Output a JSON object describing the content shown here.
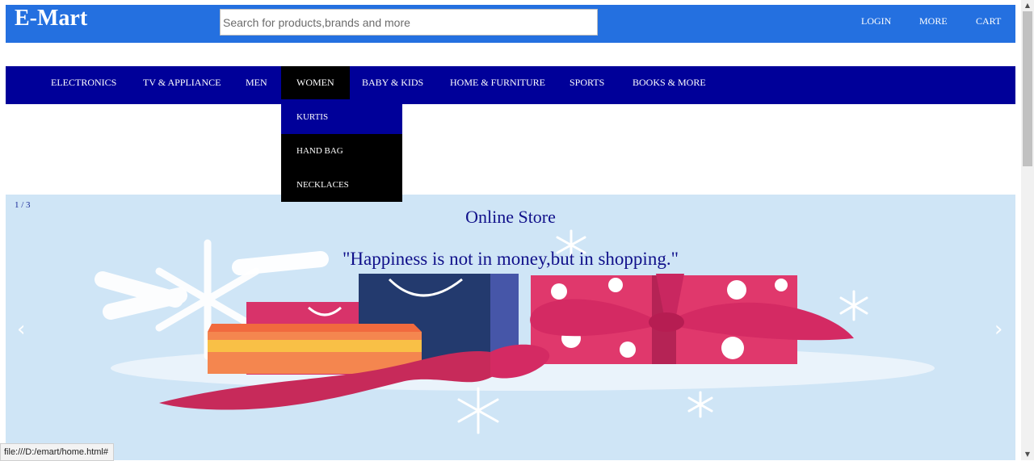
{
  "header": {
    "logo": "E-Mart",
    "search_placeholder": "Search for products,brands and more",
    "links": [
      "LOGIN",
      "MORE",
      "CART"
    ]
  },
  "nav": {
    "items": [
      "ELECTRONICS",
      "TV & APPLIANCE",
      "MEN",
      "WOMEN",
      "BABY & KIDS",
      "HOME & FURNITURE",
      "SPORTS",
      "BOOKS & MORE"
    ],
    "active": "WOMEN"
  },
  "dropdown": {
    "items": [
      "KURTIS",
      "HAND BAG",
      "NECKLACES"
    ],
    "hovered": "KURTIS"
  },
  "slider": {
    "counter": "1 / 3",
    "title": "Online Store",
    "quote": "\"Happiness is not in money,but in shopping.\"",
    "prev": "‹",
    "next": "›"
  },
  "status_url": "file:///D:/emart/home.html#",
  "colors": {
    "header_bg": "#2470e0",
    "nav_bg": "#000099",
    "active_bg": "#000000",
    "slide_bg": "#cfe5f6"
  }
}
